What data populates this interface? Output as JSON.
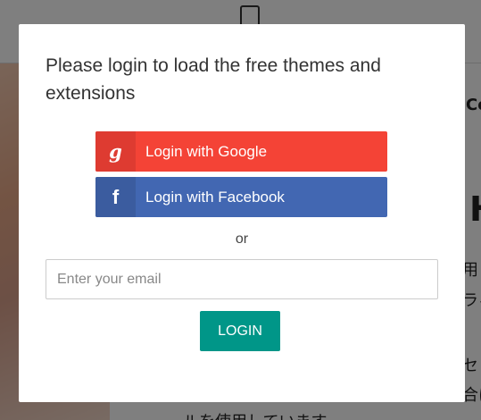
{
  "background": {
    "texts": [
      "Co",
      "H",
      "用じ",
      "ラィ",
      "セリ",
      "合は",
      "ルを使用しています"
    ]
  },
  "modal": {
    "title": "Please login to load the free themes and extensions",
    "google_button": {
      "icon": "google-icon",
      "icon_glyph": "g",
      "label": "Login with Google",
      "color": "#f44336"
    },
    "facebook_button": {
      "icon": "facebook-icon",
      "icon_glyph": "f",
      "label": "Login with Facebook",
      "color": "#4267b2"
    },
    "separator": "or",
    "email": {
      "value": "",
      "placeholder": "Enter your email"
    },
    "login_button": {
      "label": "LOGIN",
      "color": "#009688"
    }
  }
}
